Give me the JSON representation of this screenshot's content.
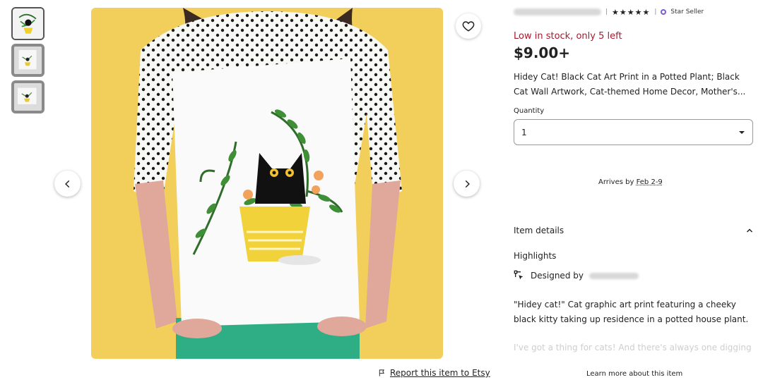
{
  "seller": {
    "rating_stars": "★★★★★",
    "separator": "|",
    "badge_label": "Star Seller"
  },
  "listing": {
    "stock_notice": "Low in stock, only 5 left",
    "price": "$9.00+",
    "title": "Hidey Cat! Black Cat Art Print in a Potted Plant; Black Cat Wall Artwork, Cat-themed Home Decor, Mother's...",
    "quantity_label": "Quantity",
    "quantity_value": "1",
    "arrives_prefix": "Arrives by",
    "arrives_date": "Feb 2-9"
  },
  "details": {
    "heading": "Item details",
    "highlights_heading": "Highlights",
    "designed_by": "Designed by",
    "description": "\"Hidey cat!\" Cat graphic art print featuring a cheeky black kitty taking up residence in a potted house plant.",
    "description_faded": "I've got a thing for cats! And there's always one digging",
    "learn_more": "Learn more about this item"
  },
  "report": {
    "label": "Report this item to Etsy"
  },
  "icons": {
    "favorite": "heart-icon",
    "prev": "chevron-left-icon",
    "next": "chevron-right-icon",
    "dropdown": "caret-down-icon",
    "collapse": "chevron-up-icon",
    "designed": "pen-tool-icon",
    "report": "flag-icon",
    "star_seller": "star-seller-badge-icon"
  },
  "colors": {
    "stock_red": "#a61a2e",
    "star_seller_purple": "#7a5bd6",
    "image_background": "#f2cf5a",
    "pants_green": "#2fae86",
    "pot_yellow": "#f1d23a"
  }
}
